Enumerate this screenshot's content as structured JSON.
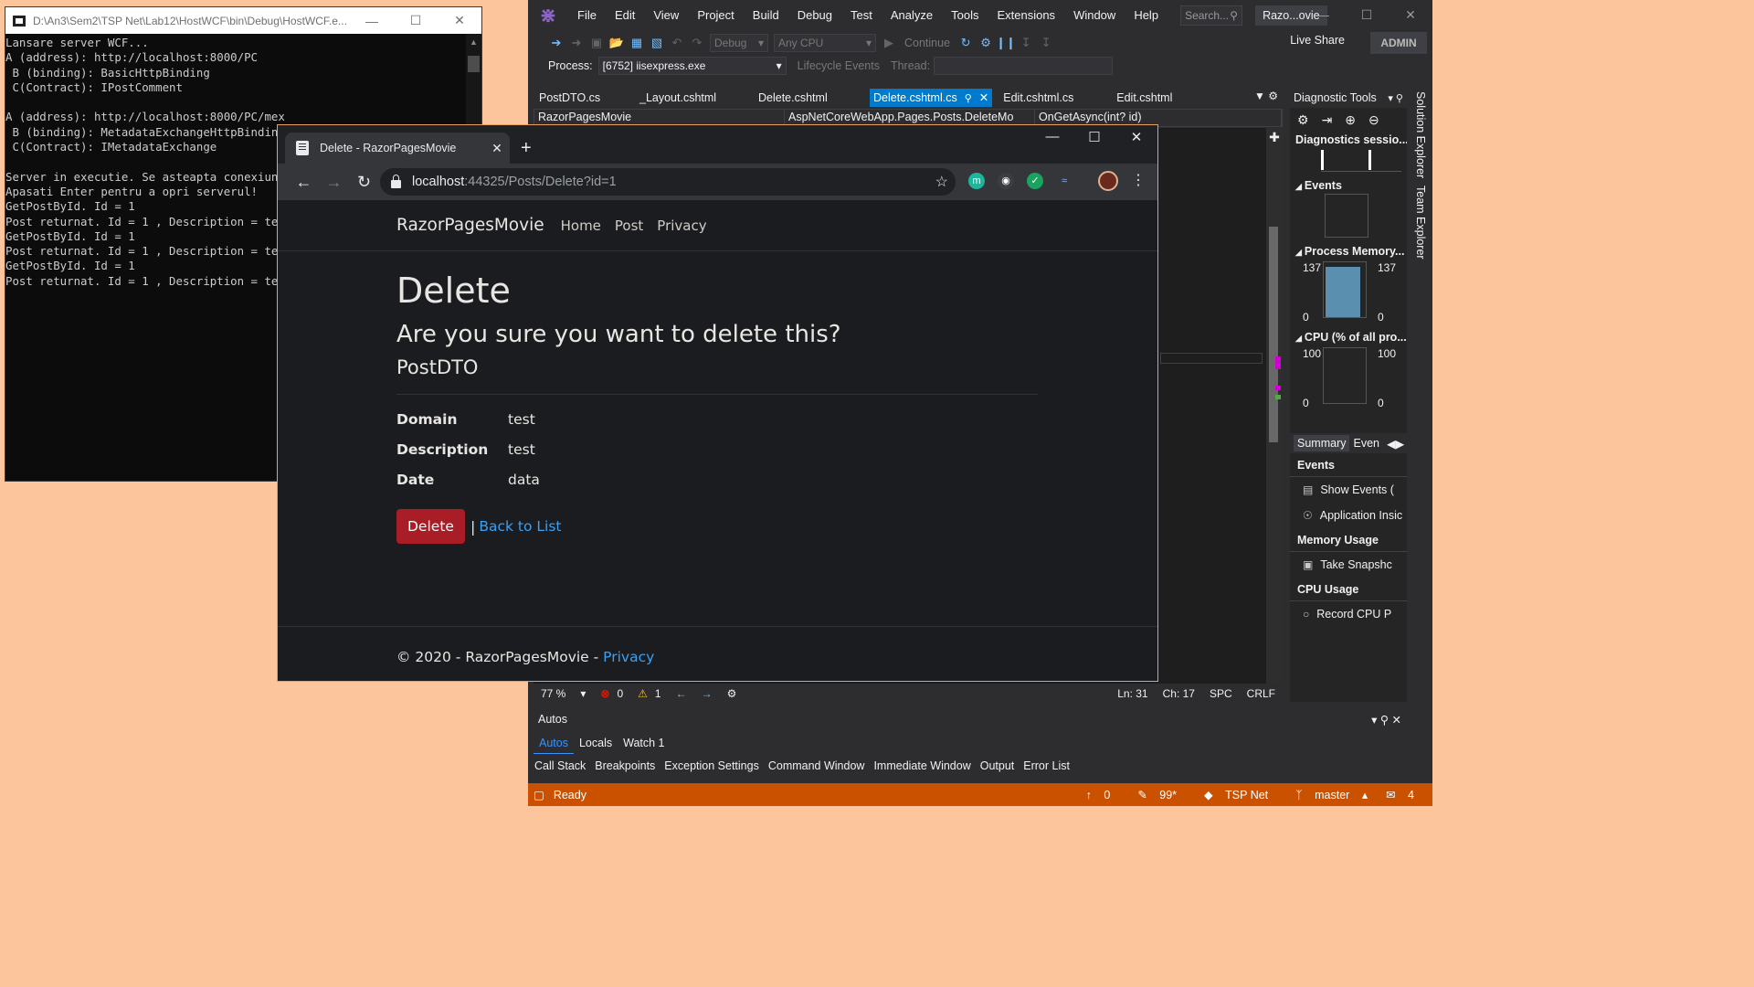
{
  "console": {
    "title": "D:\\An3\\Sem2\\TSP Net\\Lab12\\HostWCF\\bin\\Debug\\HostWCF.e...",
    "lines": [
      "Lansare server WCF...",
      "A (address): http://localhost:8000/PC",
      " B (binding): BasicHttpBinding",
      " C(Contract): IPostComment",
      "",
      "A (address): http://localhost:8000/PC/mex",
      " B (binding): MetadataExchangeHttpBinding",
      " C(Contract): IMetadataExchange",
      "",
      "Server in executie. Se asteapta conexiuni",
      "Apasati Enter pentru a opri serverul!",
      "GetPostById. Id = 1",
      "Post returnat. Id = 1 , Description = test",
      "GetPostById. Id = 1",
      "Post returnat. Id = 1 , Description = test",
      "GetPostById. Id = 1",
      "Post returnat. Id = 1 , Description = test"
    ]
  },
  "vs": {
    "menu": [
      "File",
      "Edit",
      "View",
      "Project",
      "Build",
      "Debug",
      "Test",
      "Analyze",
      "Tools",
      "Extensions",
      "Window",
      "Help"
    ],
    "search_placeholder": "Search...",
    "solution_name": "Razo...ovie",
    "config": "Debug",
    "platform": "Any CPU",
    "continue_label": "Continue",
    "live_share": "Live Share",
    "admin": "ADMIN",
    "process_label": "Process:",
    "process_value": "[6752] iisexpress.exe",
    "lifecycle_label": "Lifecycle Events",
    "thread_label": "Thread:",
    "tabs": [
      {
        "label": "PostDTO.cs",
        "active": false
      },
      {
        "label": "_Layout.cshtml",
        "active": false
      },
      {
        "label": "Delete.cshtml",
        "active": false
      },
      {
        "label": "Delete.cshtml.cs",
        "active": true
      },
      {
        "label": "Edit.cshtml.cs",
        "active": false
      },
      {
        "label": "Edit.cshtml",
        "active": false
      }
    ],
    "nav_project": "RazorPagesMovie",
    "nav_class": "AspNetCoreWebApp.Pages.Posts.DeleteMo",
    "nav_member": "OnGetAsync(int? id)",
    "zoom": "77 %",
    "errors": "0",
    "warnings": "1",
    "line": "Ln: 31",
    "col": "Ch: 17",
    "spc": "SPC",
    "crlf": "CRLF",
    "autos_title": "Autos",
    "autos_tabs": [
      "Autos",
      "Locals",
      "Watch 1"
    ],
    "bottom_tools": [
      "Call Stack",
      "Breakpoints",
      "Exception Settings",
      "Command Window",
      "Immediate Window",
      "Output",
      "Error List"
    ],
    "status_ready": "Ready",
    "status_push": "0",
    "status_changes": "99*",
    "status_repo": "TSP Net",
    "status_branch": "master",
    "status_notifications": "4"
  },
  "diag": {
    "title": "Diagnostic Tools",
    "session": "Diagnostics sessio...",
    "events": "Events",
    "memory_title": "Process Memory...",
    "memory_max": "137",
    "memory_min": "0",
    "memory_level": 0.92,
    "cpu_title": "CPU (% of all pro...",
    "cpu_max": "100",
    "cpu_min": "0",
    "tab_summary": "Summary",
    "tab_events": "Even",
    "events_header": "Events",
    "show_events": "Show Events (",
    "app_insights": "Application Insic",
    "memory_usage": "Memory Usage",
    "take_snapshot": "Take Snapshc",
    "cpu_usage": "CPU Usage",
    "record_cpu": "Record CPU P",
    "side_tabs": [
      "Solution Explorer",
      "Team Explorer"
    ]
  },
  "browser": {
    "tab_title": "Delete - RazorPagesMovie",
    "url_host": "localhost",
    "url_path": ":44325/Posts/Delete?id=1"
  },
  "page": {
    "brand": "RazorPagesMovie",
    "nav": [
      "Home",
      "Post",
      "Privacy"
    ],
    "h1": "Delete",
    "h3": "Are you sure you want to delete this?",
    "h4": "PostDTO",
    "fields": [
      {
        "label": "Domain",
        "value": "test"
      },
      {
        "label": "Description",
        "value": "test"
      },
      {
        "label": "Date",
        "value": "data"
      }
    ],
    "delete_button": "Delete",
    "separator": "|",
    "back_link": "Back to List",
    "footer_text": "© 2020 - RazorPagesMovie - ",
    "footer_link": "Privacy"
  }
}
